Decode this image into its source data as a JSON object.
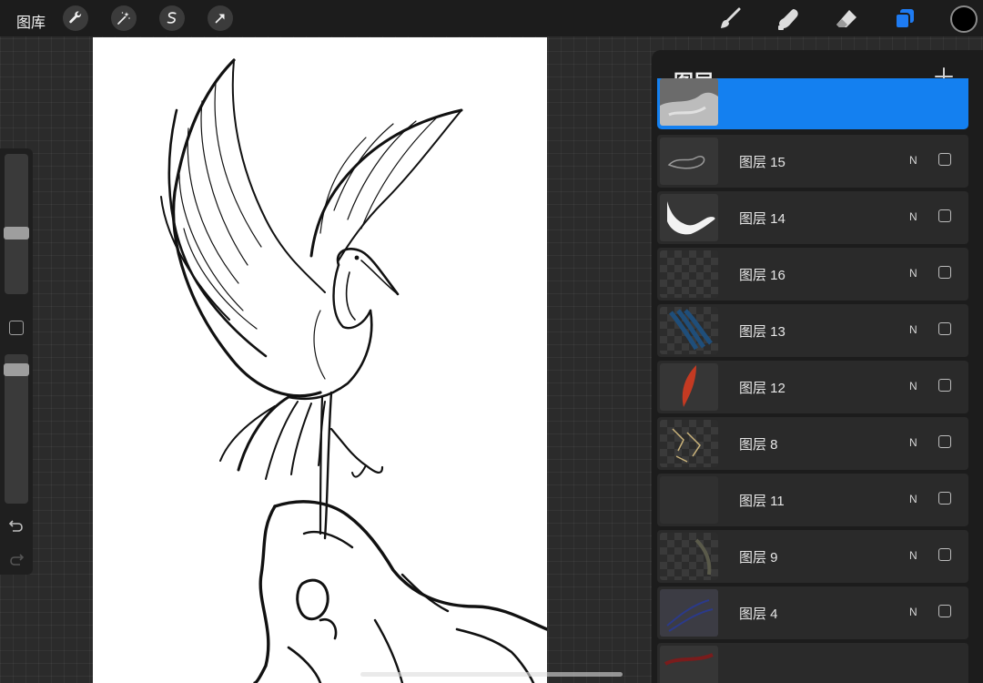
{
  "topbar": {
    "gallery_label": "图库",
    "left_tools": [
      "wrench-icon",
      "magic-wand-icon",
      "selection-icon",
      "transform-arrow-icon"
    ],
    "right_tools": [
      "brush-icon",
      "smudge-icon",
      "eraser-icon",
      "layers-icon"
    ],
    "active_tool_color": "#1e7bf2",
    "current_color": "#000000"
  },
  "layers_panel": {
    "title": "图层",
    "add_icon": "plus-icon",
    "active_color": "#1480f0",
    "layers": [
      {
        "name": "图层 15",
        "mode": "N"
      },
      {
        "name": "图层 14",
        "mode": "N"
      },
      {
        "name": "图层 16",
        "mode": "N"
      },
      {
        "name": "图层 13",
        "mode": "N"
      },
      {
        "name": "图层 12",
        "mode": "N"
      },
      {
        "name": "图层 8",
        "mode": "N"
      },
      {
        "name": "图层 11",
        "mode": "N"
      },
      {
        "name": "图层 9",
        "mode": "N"
      },
      {
        "name": "图层 4",
        "mode": "N"
      }
    ]
  },
  "sidebar": {
    "undo_icon": "undo-icon",
    "redo_icon": "redo-icon"
  }
}
